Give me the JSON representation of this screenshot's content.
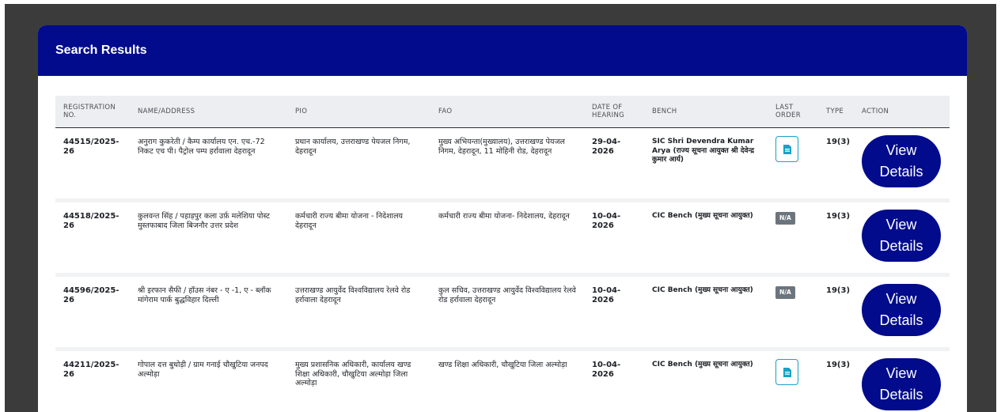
{
  "header": {
    "title": "Search Results"
  },
  "columns": {
    "reg": "REGISTRATION NO.",
    "name": "NAME/ADDRESS",
    "pio": "PIO",
    "fao": "FAO",
    "date": "DATE OF HEARING",
    "bench": "BENCH",
    "last_order": "LAST ORDER",
    "type": "TYPE",
    "action": "ACTION"
  },
  "rows": [
    {
      "reg": "44515/2025-26",
      "name": "अनुराग कुकरेती / कैम्प कार्यालय एन. एच.-72 निकट एच पी। पैट्रोल पम्प हर्रावाला देहरादून",
      "pio": "प्रधान कार्यालय, उत्तराखण्ड पेयजल निगम, देहरादून",
      "fao": "मुख्य अभियन्ता(मुख्यालय), उत्तराखण्ड पेयजल निगम, देहरादून, 11 मोहिनी रोड, देहरादून",
      "date": "29-04-2026",
      "bench": "SIC Shri Devendra Kumar Arya (राज्य सूचना आयुक्त श्री देवेन्द्र कुमार आर्य)",
      "last_order": "",
      "last_order_icon": "document-icon",
      "type": "19(3)",
      "action": "View Details"
    },
    {
      "reg": "44518/2025-26",
      "name": "कुलवन्त सिंह / पहाड़पुर कला उर्फ़ मलेशिया पोस्ट मुस्तफाबाद जिला बिजनौर उत्तर प्रदेश",
      "pio": "कर्मचारी राज्य बीमा योजना - निदेशालय देहरादून",
      "fao": "कर्मचारी राज्य बीमा योजना- निदेशालय, देहरादून",
      "date": "10-04-2026",
      "bench": "CIC Bench (मुख्य सूचना आयुक्त)",
      "last_order": "N/A",
      "last_order_icon": "",
      "type": "19(3)",
      "action": "View Details"
    },
    {
      "reg": "44596/2025-26",
      "name": "श्री इरफान सैफी / हॉउस नंबर - ए -1, ए - ब्लॉक मांगेराम पार्क बुद्धविहार दिल्ली",
      "pio": "उत्तराखण्ड आयुर्वेद विश्वविद्यालय रेलवे रोड हर्रावाला देहरादून",
      "fao": "कुल सचिव, उत्तराखण्ड आयुर्वेद विश्वविद्यालय रेलवे रोड हर्रावाला देहरादून",
      "date": "10-04-2026",
      "bench": "CIC Bench (मुख्य सूचना आयुक्त)",
      "last_order": "N/A",
      "last_order_icon": "",
      "type": "19(3)",
      "action": "View Details"
    },
    {
      "reg": "44211/2025-26",
      "name": "गोपाल दत्त बुधोड़ी / ग्राम गनाई चौखुटिया जनपद अल्मोड़ा",
      "pio": "मुख्य प्रशासनिक अधिकारी, कार्यालय खण्ड शिक्षा अधिकारी, चौखुटिया अल्मोड़ा जिला अल्मोड़ा",
      "fao": "खण्ड शिक्षा अधिकारी, चौखुटिया जिला अल्मोड़ा",
      "date": "10-04-2026",
      "bench": "CIC Bench (मुख्य सूचना आयुक्त)",
      "last_order": "",
      "last_order_icon": "document-icon",
      "type": "19(3)",
      "action": "View Details"
    }
  ],
  "colors": {
    "header_bg": "#010b8c",
    "button_bg": "#010b8c",
    "doc_icon": "#17a2c6",
    "badge_bg": "#6c757d"
  }
}
